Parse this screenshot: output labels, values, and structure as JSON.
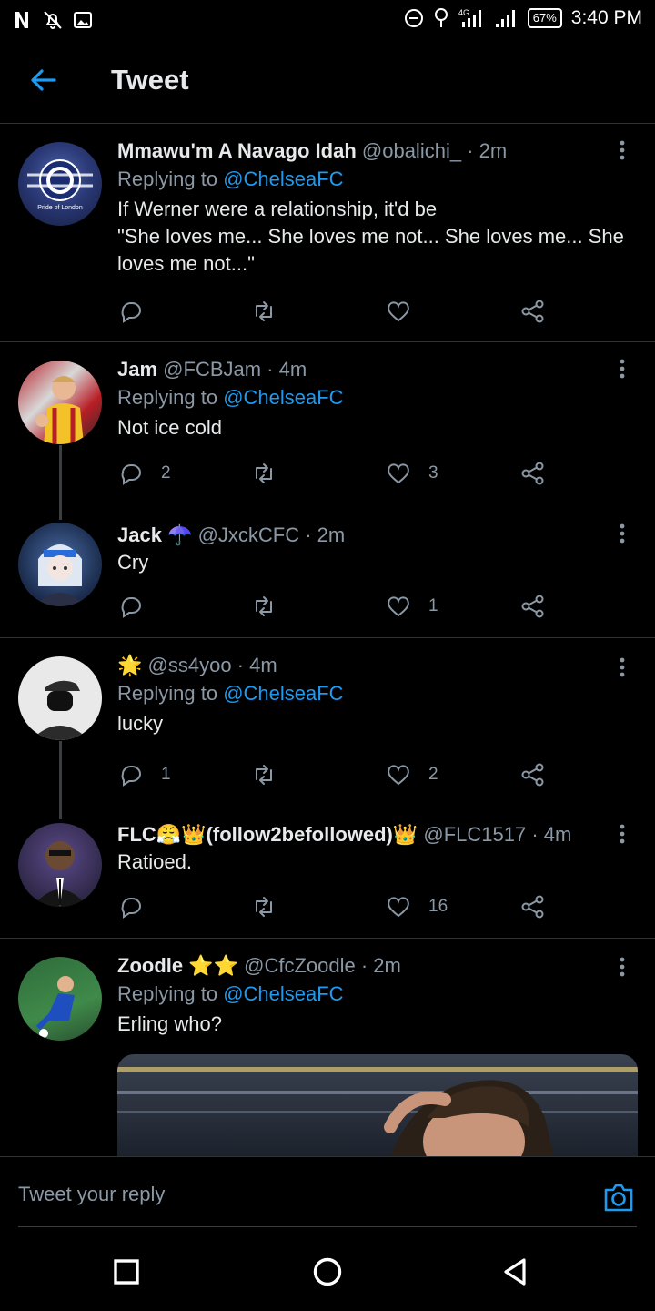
{
  "status_bar": {
    "icons": [
      "netflix-n-icon",
      "notifications-off-icon",
      "image-icon"
    ],
    "right_icons": [
      "dnd-icon",
      "hotspot-icon",
      "signal-4g-icon",
      "signal-icon"
    ],
    "battery": "67%",
    "time": "3:40 PM"
  },
  "header": {
    "title": "Tweet"
  },
  "tweets": [
    {
      "name": "Mmawu'm A Navago Idah",
      "handle": "@obalichi_ · 2m",
      "reply_prefix": "Replying to ",
      "reply_to": "@ChelseaFC",
      "text": "If Werner were a relationship, it'd be\n\"She loves me... She loves me not... She loves me... She loves me not...\"",
      "reply_count": "",
      "like_count": "",
      "avatar_label": "Pride of London"
    },
    {
      "name": "Jam",
      "handle": "@FCBJam · 4m",
      "reply_prefix": "Replying to ",
      "reply_to": "@ChelseaFC",
      "text": "Not ice cold",
      "reply_count": "2",
      "like_count": "3"
    },
    {
      "name": "Jack ☂️",
      "handle": "@JxckCFC · 2m",
      "text": "Cry",
      "reply_count": "",
      "like_count": "1"
    },
    {
      "name": "🌟",
      "handle": "@ss4yoo · 4m",
      "reply_prefix": "Replying to ",
      "reply_to": "@ChelseaFC",
      "text": "lucky",
      "reply_count": "1",
      "like_count": "2"
    },
    {
      "name": "FLC😤👑(follow2befollowed)👑",
      "handle": "@FLC1517 · 4m",
      "text": "Ratioed.",
      "reply_count": "",
      "like_count": "16"
    },
    {
      "name": "Zoodle ⭐⭐",
      "handle": "@CfcZoodle · 2m",
      "reply_prefix": "Replying to ",
      "reply_to": "@ChelseaFC",
      "text": "Erling who?",
      "reply_count": "",
      "like_count": ""
    }
  ],
  "reply_bar": {
    "placeholder": "Tweet your reply"
  },
  "colors": {
    "accent": "#1d9bf0",
    "muted": "#8b98a5",
    "text": "#e7e9ea",
    "divider": "#2f3336",
    "background": "#000000"
  }
}
